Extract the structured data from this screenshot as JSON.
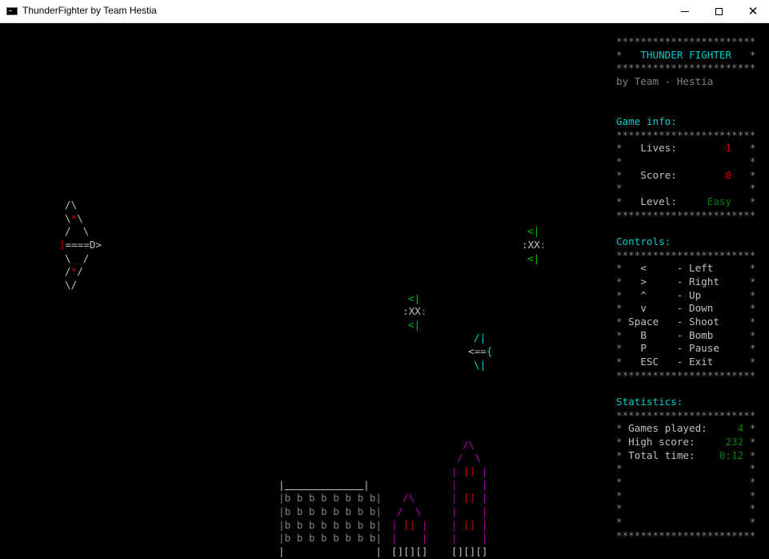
{
  "window": {
    "title": "ThunderFighter by Team Hestia",
    "minimize": "–",
    "maximize": "☐",
    "close": "✕"
  },
  "sidebar": {
    "stars": "***********************",
    "title_line": "*   THUNDER FIGHTER   *",
    "subtitle": "by Team - Hestia",
    "game_info": {
      "heading": "Game info:",
      "lives_label": "Lives:",
      "lives_value": "1",
      "score_label": "Score:",
      "score_value": "0",
      "level_label": "Level:",
      "level_value": "Easy"
    },
    "controls": {
      "heading": "Controls:",
      "items": [
        {
          "key": "<",
          "action": "Left"
        },
        {
          "key": ">",
          "action": "Right"
        },
        {
          "key": "^",
          "action": "Up"
        },
        {
          "key": "v",
          "action": "Down"
        },
        {
          "key": "Space",
          "action": "Shoot"
        },
        {
          "key": "B",
          "action": "Bomb"
        },
        {
          "key": "P",
          "action": "Pause"
        },
        {
          "key": "ESC",
          "action": "Exit"
        }
      ]
    },
    "statistics": {
      "heading": "Statistics:",
      "games_label": "Games played:",
      "games_value": "4",
      "high_label": "High score:",
      "high_value": "232",
      "time_label": "Total time:",
      "time_value": "0:12"
    }
  },
  "game": {
    "player_ship": {
      "l1": "/\\",
      "l2a": "\\",
      "l2b": "*",
      "l2c": "\\",
      "l3": "/  \\",
      "l4a": "]",
      "l4b": "====D>",
      "l5": "\\  /",
      "l6a": "/",
      "l6b": "*",
      "l6c": "/",
      "l7": "\\/"
    },
    "enemy": {
      "top": "<|",
      "body": ":XX",
      "body_tail": ":",
      "bottom": "<|"
    },
    "enemy_alt": {
      "top": "/|",
      "body": "<=={",
      "bottom": "\\|"
    },
    "building_wide": {
      "roof": "|___________|",
      "floor": "|b b b b b b b b|",
      "base": "|           |"
    },
    "tower_small": {
      "l1": "/\\",
      "l2": "/  \\",
      "l3a": "|",
      "l3b": "[]",
      "l3c": "|",
      "l4": "|    |",
      "base": "[][][]"
    },
    "tower_tall": {
      "l1": "/\\",
      "l2": "/  \\",
      "wall": "|    |",
      "win": "[]",
      "base": "[][][]"
    }
  }
}
